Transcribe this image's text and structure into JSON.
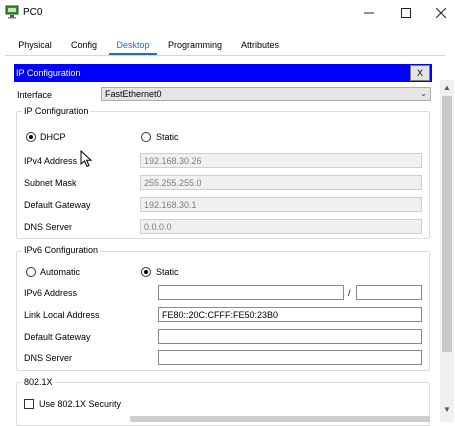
{
  "window": {
    "title": "PC0",
    "minimize_glyph": "—",
    "maximize_glyph": "☐",
    "close_glyph": "✕"
  },
  "tabs": [
    {
      "label": "Physical"
    },
    {
      "label": "Config"
    },
    {
      "label": "Desktop"
    },
    {
      "label": "Programming"
    },
    {
      "label": "Attributes"
    }
  ],
  "active_tab": "Desktop",
  "ip_config": {
    "header_title": "IP Configuration",
    "close_label": "X",
    "interface_label": "Interface",
    "interface_value": "FastEthernet0",
    "ipv4": {
      "group_title": "IP Configuration",
      "dhcp_label": "DHCP",
      "static_label": "Static",
      "mode": "DHCP",
      "ipv4_address_label": "IPv4 Address",
      "ipv4_address": "192.168.30.26",
      "subnet_mask_label": "Subnet Mask",
      "subnet_mask": "255.255.255.0",
      "default_gateway_label": "Default Gateway",
      "default_gateway": "192.168.30.1",
      "dns_server_label": "DNS Server",
      "dns_server": "0.0.0.0"
    },
    "ipv6": {
      "group_title": "IPv6 Configuration",
      "automatic_label": "Automatic",
      "static_label": "Static",
      "mode": "Static",
      "ipv6_address_label": "IPv6 Address",
      "ipv6_address": "",
      "prefix_separator": "/",
      "prefix_length": "",
      "link_local_label": "Link Local Address",
      "link_local_address": "FE80::20C:CFFF:FE50:23B0",
      "default_gateway_label": "Default Gateway",
      "default_gateway": "",
      "dns_server_label": "DNS Server",
      "dns_server": ""
    },
    "dot1x": {
      "group_title": "802.1X",
      "use_label": "Use 802.1X Security",
      "checked": false
    }
  },
  "colors": {
    "header_bar": "#0000ff",
    "active_tab": "#1a6fd1"
  }
}
